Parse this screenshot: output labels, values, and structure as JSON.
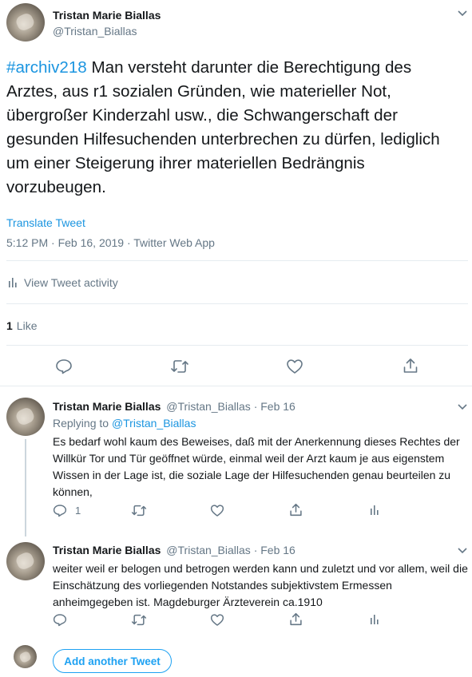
{
  "main_tweet": {
    "author_name": "Tristan Marie Biallas",
    "author_handle": "@Tristan_Biallas",
    "hashtag": "#archiv218",
    "text": " Man versteht darunter die Berechtigung des Arztes, aus r1 sozialen Gründen, wie materieller Not, übergroßer Kinderzahl usw., die Schwangerschaft der gesunden Hilfesuchenden unterbrechen zu dürfen, lediglich um einer Steigerung ihrer materiellen Bedrängnis vorzubeugen.",
    "translate_label": "Translate Tweet",
    "timestamp": "5:12 PM · Feb 16, 2019 · Twitter Web App",
    "activity_label": "View Tweet activity",
    "like_count": "1",
    "like_label": "Like"
  },
  "replies": [
    {
      "author_name": "Tristan Marie Biallas",
      "meta": "@Tristan_Biallas · Feb 16",
      "replying_prefix": "Replying to ",
      "replying_handle": "@Tristan_Biallas",
      "text": "Es bedarf wohl kaum des Beweises, daß mit der Anerkennung dieses Rechtes der Willkür Tor und Tür geöffnet würde, einmal weil der Arzt kaum je aus eigenstem Wissen in der Lage ist, die soziale Lage der Hilfesuchenden genau beurteilen zu können,",
      "reply_count": "1"
    },
    {
      "author_name": "Tristan Marie Biallas",
      "meta": "@Tristan_Biallas · Feb 16",
      "text": "weiter weil er belogen und betrogen werden kann und zuletzt und vor allem, weil die Einschätzung des vorliegenden Notstandes subjektivstem Ermessen anheimgegeben ist. Magdeburger Ärzteverein ca.1910",
      "reply_count": ""
    }
  ],
  "composer": {
    "add_button_label": "Add another Tweet"
  },
  "colors": {
    "link_blue": "#1b95e0",
    "muted_grey": "#657786",
    "divider": "#e6ecf0",
    "button_blue": "#1da1f2"
  }
}
